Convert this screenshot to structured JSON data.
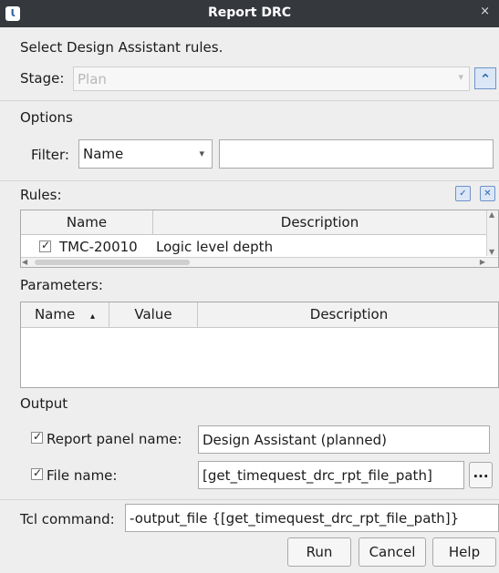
{
  "dialog": {
    "title": "Report DRC",
    "close_glyph": "×",
    "app_icon": "Ɩ"
  },
  "instructions": "Select Design Assistant rules.",
  "stage": {
    "label": "Stage:",
    "value": "Plan",
    "dropdown_glyph": "▾",
    "collapse_glyph": "⌃"
  },
  "options": {
    "heading": "Options",
    "filter_label": "Filter:",
    "filter_type": "Name",
    "filter_dropdown_glyph": "▾",
    "filter_text": ""
  },
  "rules": {
    "heading": "Rules:",
    "columns": [
      "Name",
      "Description"
    ],
    "rows": [
      {
        "checked": true,
        "name": "TMC-20010",
        "description": "Logic level depth"
      }
    ],
    "check_glyph": "✓"
  },
  "parameters": {
    "heading": "Parameters:",
    "columns": [
      "Name",
      "Value",
      "Description"
    ],
    "sort_glyph": "▴"
  },
  "output": {
    "heading": "Output",
    "report_panel_label": "Report panel name:",
    "report_panel_value": "Design Assistant (planned)",
    "file_name_label": "File name:",
    "file_name_value": "[get_timequest_drc_rpt_file_path]",
    "browse_label": "..."
  },
  "tcl": {
    "label": "Tcl command:",
    "value": "-output_file {[get_timequest_drc_rpt_file_path]}"
  },
  "buttons": {
    "run": "Run",
    "cancel": "Cancel",
    "help": "Help"
  },
  "colors": {
    "titlebar": "#35393d",
    "background": "#eeeeee",
    "accent": "#2d66b0"
  }
}
